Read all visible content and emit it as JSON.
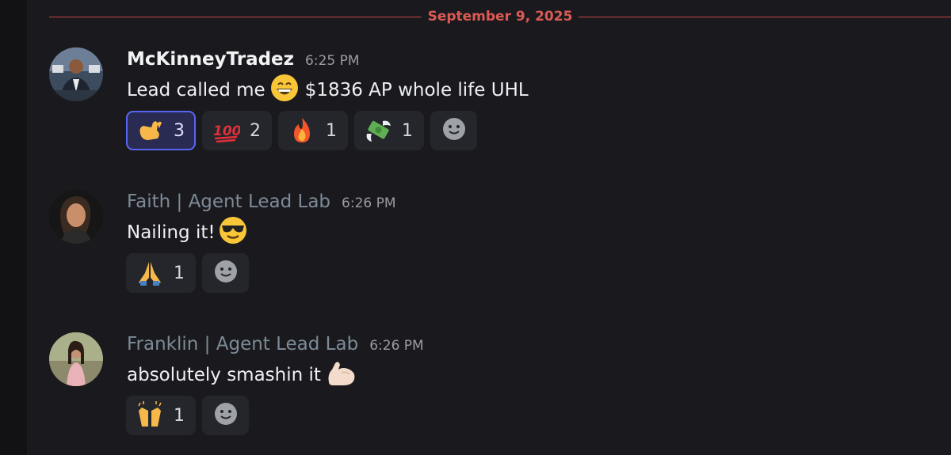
{
  "date_divider": "September 9, 2025",
  "messages": [
    {
      "author": "McKinneyTradez",
      "time": "6:25 PM",
      "text_before": "Lead called me",
      "text_after": "$1836 AP whole life UHL",
      "inline_emoji": "grinning-face",
      "reactions": [
        {
          "emoji": "call-me-hand",
          "count": "3",
          "selected": true
        },
        {
          "emoji": "hundred-points",
          "count": "2",
          "selected": false
        },
        {
          "emoji": "fire",
          "count": "1",
          "selected": false
        },
        {
          "emoji": "money-with-wings",
          "count": "1",
          "selected": false
        }
      ]
    },
    {
      "author": "Faith | Agent Lead Lab",
      "time": "6:26 PM",
      "text_before": "Nailing it!",
      "inline_emoji": "sunglasses-face",
      "reactions": [
        {
          "emoji": "folded-hands",
          "count": "1",
          "selected": false
        }
      ]
    },
    {
      "author": "Franklin | Agent Lead Lab",
      "time": "6:26 PM",
      "text_before": "absolutely smashin it",
      "inline_emoji": "flexed-biceps",
      "reactions": [
        {
          "emoji": "raising-hands",
          "count": "1",
          "selected": false
        }
      ]
    }
  ],
  "colors": {
    "background": "#1a1a1e",
    "divider": "#c7443f",
    "selected_reaction_border": "#5865f2"
  }
}
